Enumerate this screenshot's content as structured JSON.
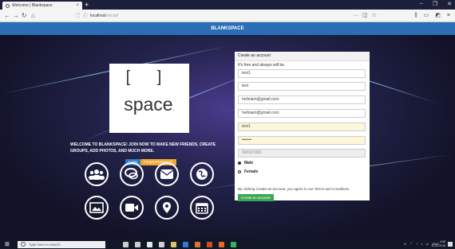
{
  "browser": {
    "tab_title": "Welcome | Blankspace",
    "tab_close": "×",
    "new_tab": "+",
    "url": "localhost",
    "url_path": "/social/",
    "url_menu": "···",
    "win_min": "–",
    "win_max": "❐",
    "win_close": "✕"
  },
  "site": {
    "brand": "BLANKSPACE",
    "logo_brackets": "[ ]",
    "logo_word": "space",
    "logo_dot": ".",
    "welcome_text": "WELCOME TO BLANKSPACE! JOIN NOW TO MAKE NEW FRIENDS, CREATE GROUPS, ADD PHOTOS, AND MUCH MORE.",
    "login_label": "Login",
    "forgot_label": "Forgot Password?"
  },
  "features": [
    {
      "icon": "users-icon"
    },
    {
      "icon": "chat-icon"
    },
    {
      "icon": "mail-icon"
    },
    {
      "icon": "globe-icon"
    },
    {
      "icon": "image-icon"
    },
    {
      "icon": "video-icon"
    },
    {
      "icon": "location-icon"
    },
    {
      "icon": "calendar-icon"
    }
  ],
  "form": {
    "title": "Create an account",
    "subtitle": "It's free and always will be.",
    "first_name": "test1",
    "last_name": "test",
    "email": "helloiam@gmail.com",
    "email_confirm": "helloiam@gmail.com",
    "username": "test1",
    "password": "•••••••",
    "birthday": "06/02/1991",
    "gender_male": "Male",
    "gender_female": "Female",
    "terms": "By clicking Create an account, you agree to our Terms and Conditions",
    "submit_label": "Create an account"
  },
  "taskbar": {
    "search_placeholder": "Type here to search",
    "lang": "ENG",
    "time": "3:58",
    "date": "11-02-2018"
  },
  "colors": {
    "brand_bar": "#2a6eb5",
    "login": "#2a7cc7",
    "forgot": "#f0a630",
    "create": "#3aa852"
  }
}
